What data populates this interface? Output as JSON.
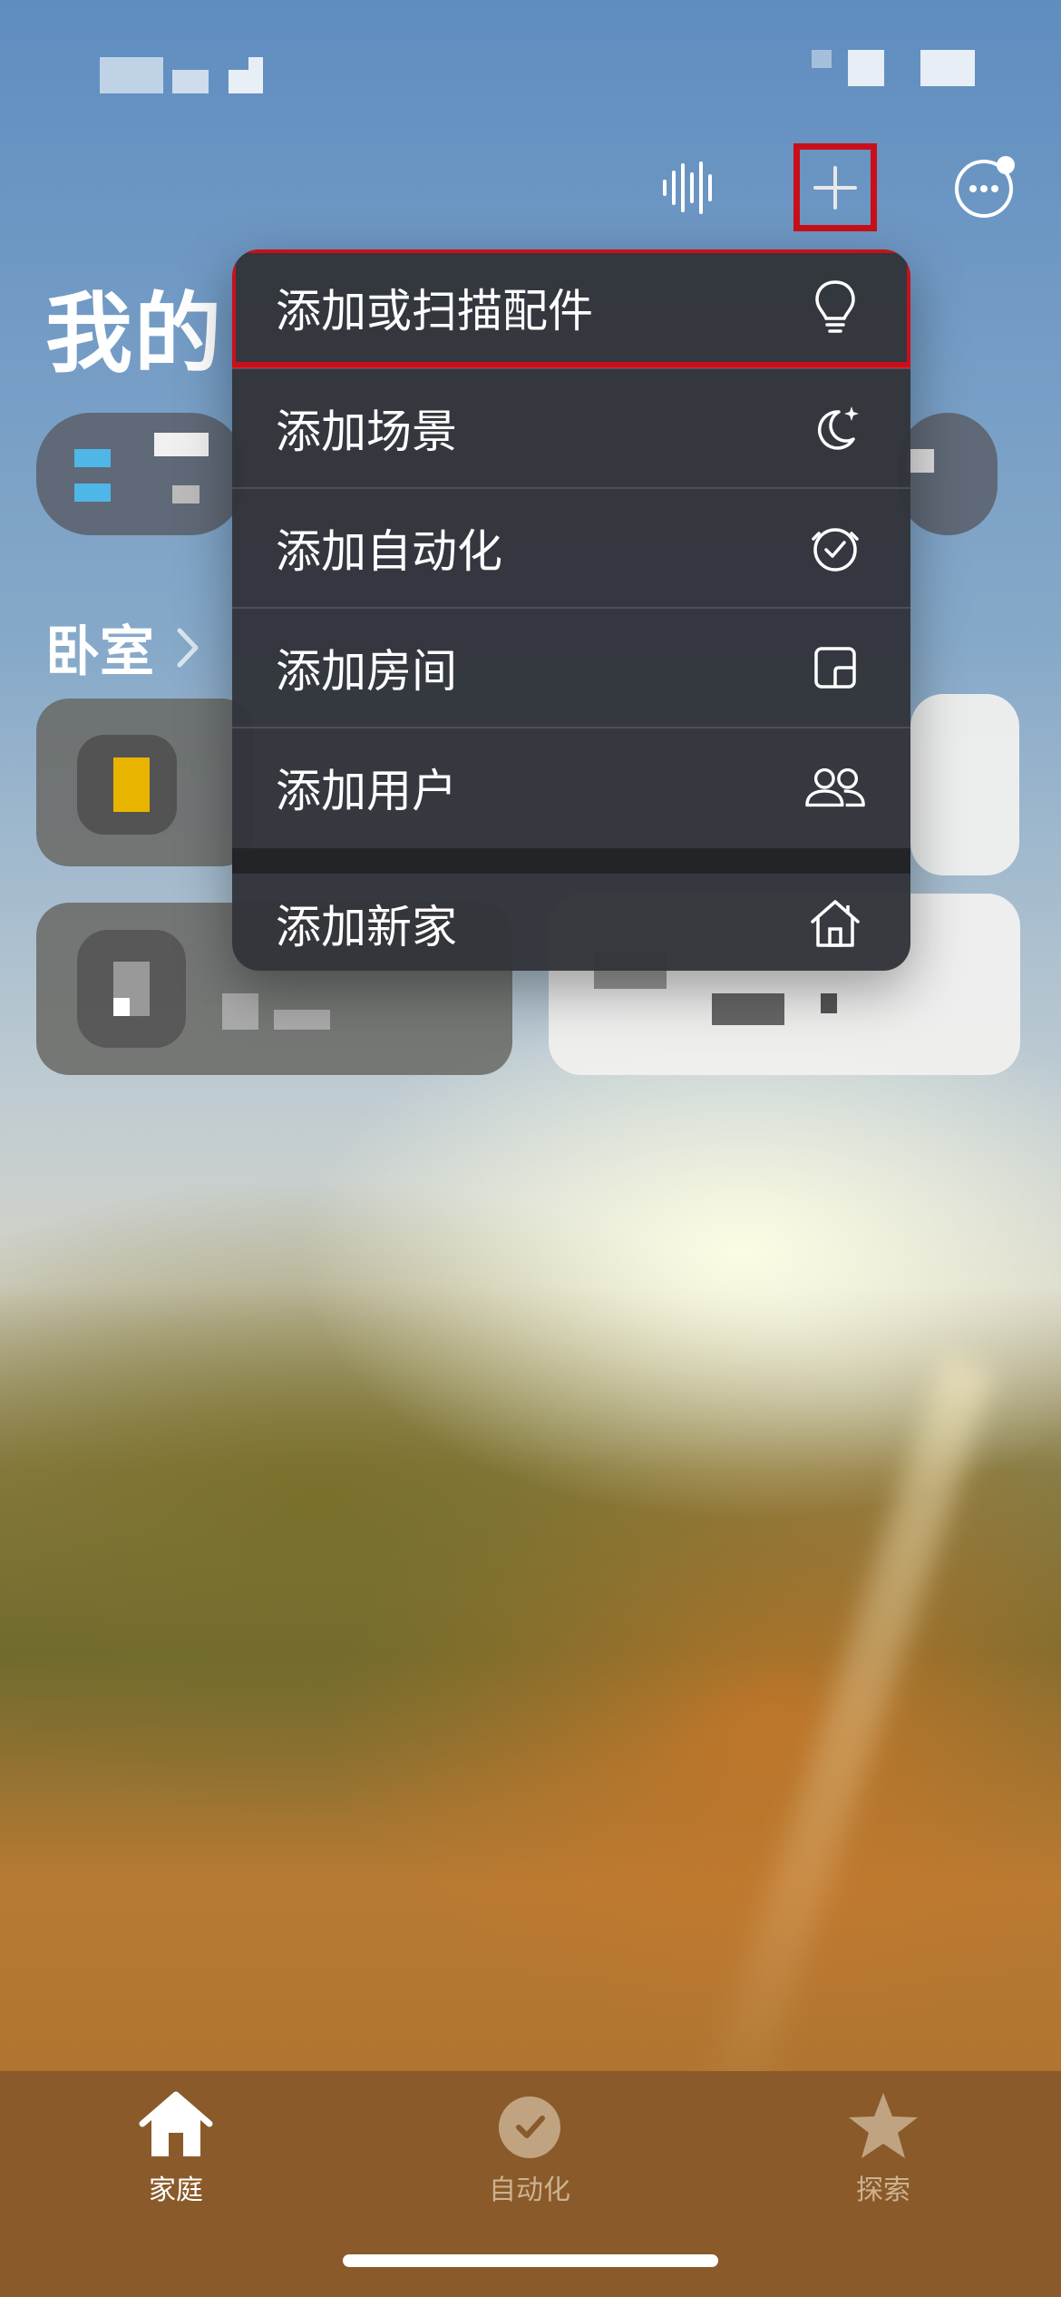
{
  "home": {
    "title": "我的",
    "room_label": "卧室"
  },
  "add_menu": {
    "items": [
      {
        "label": "添加或扫描配件",
        "icon": "lightbulb-icon"
      },
      {
        "label": "添加场景",
        "icon": "moon-sparkle-icon"
      },
      {
        "label": "添加自动化",
        "icon": "clock-icon"
      },
      {
        "label": "添加房间",
        "icon": "room-icon"
      },
      {
        "label": "添加用户",
        "icon": "people-icon"
      },
      {
        "label": "添加新家",
        "icon": "house-icon"
      }
    ]
  },
  "tabbar": {
    "tabs": [
      {
        "label": "家庭",
        "icon": "house-icon",
        "active": true
      },
      {
        "label": "自动化",
        "icon": "clock-icon",
        "active": false
      },
      {
        "label": "探索",
        "icon": "star-icon",
        "active": false
      }
    ]
  },
  "colors": {
    "highlight": "#c8101a",
    "menu_bg": "#32343a",
    "tabbar_bg": "#8a5a2a"
  }
}
